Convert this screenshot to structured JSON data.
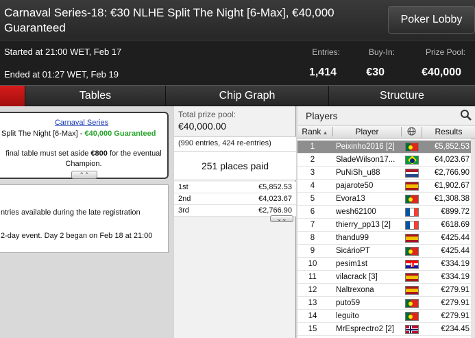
{
  "header": {
    "title": "Carnaval Series-18: €30 NLHE Split The Night [6-Max], €40,000 Guaranteed",
    "lobby_button": "Poker Lobby",
    "started": "Started at 21:00 WET, Feb 17",
    "ended": "Ended at 01:27 WET, Feb 19",
    "stats": {
      "entries_label": "Entries:",
      "entries_value": "1,414",
      "buyin_label": "Buy-In:",
      "buyin_value": "€30",
      "prize_label": "Prize Pool:",
      "prize_value": "€40,000"
    }
  },
  "tabs": [
    {
      "label": ""
    },
    {
      "label": "Tables"
    },
    {
      "label": "Chip Graph"
    },
    {
      "label": "Structure"
    }
  ],
  "info": {
    "link": "Carnaval Series",
    "subline_a": "Split The Night [6-Max]",
    "subline_sep": " - ",
    "subline_b": "€40,000 Guaranteed",
    "note_a": "final table must set aside ",
    "note_bold": "€800",
    "note_b": " for the eventual Champion.",
    "late_reg": "ntries available during the late registration",
    "day2": "2-day event. Day 2 began on Feb 18 at 21:00"
  },
  "prize": {
    "label": "Total prize pool:",
    "value": "€40,000.00",
    "entries": "(990 entries, 424 re-entries)",
    "places": "251 places paid",
    "payouts": [
      {
        "place": "1st",
        "amount": "€5,852.53"
      },
      {
        "place": "2nd",
        "amount": "€4,023.67"
      },
      {
        "place": "3rd",
        "amount": "€2,766.90"
      }
    ]
  },
  "players": {
    "title": "Players",
    "columns": {
      "rank": "Rank",
      "player": "Player",
      "results": "Results"
    },
    "rows": [
      {
        "rank": "1",
        "name": "Peixinho2016 [2]",
        "flag": "portugal",
        "result": "€5,852.53"
      },
      {
        "rank": "2",
        "name": "SladeWilson17...",
        "flag": "brazil",
        "result": "€4,023.67"
      },
      {
        "rank": "3",
        "name": "PuNiSh_u88",
        "flag": "netherlands",
        "result": "€2,766.90"
      },
      {
        "rank": "4",
        "name": "pajarote50",
        "flag": "spain",
        "result": "€1,902.67"
      },
      {
        "rank": "5",
        "name": "Evora13",
        "flag": "portugal",
        "result": "€1,308.38"
      },
      {
        "rank": "6",
        "name": "wesh62100",
        "flag": "france",
        "result": "€899.72"
      },
      {
        "rank": "7",
        "name": "thierry_pp13 [2]",
        "flag": "france",
        "result": "€618.69"
      },
      {
        "rank": "8",
        "name": "thandu99",
        "flag": "spain",
        "result": "€425.44"
      },
      {
        "rank": "9",
        "name": "SicárioPT",
        "flag": "portugal",
        "result": "€425.44"
      },
      {
        "rank": "10",
        "name": "pesim1st",
        "flag": "croatia",
        "result": "€334.19"
      },
      {
        "rank": "11",
        "name": "vilacrack [3]",
        "flag": "spain",
        "result": "€334.19"
      },
      {
        "rank": "12",
        "name": "Naltrexona",
        "flag": "spain",
        "result": "€279.91"
      },
      {
        "rank": "13",
        "name": "puto59",
        "flag": "portugal",
        "result": "€279.91"
      },
      {
        "rank": "14",
        "name": "leguito",
        "flag": "portugal",
        "result": "€279.91"
      },
      {
        "rank": "15",
        "name": "MrEsprectro2 [2]",
        "flag": "norway",
        "result": "€234.45"
      }
    ]
  },
  "colors": {
    "accent_red": "#c31313",
    "guarantee_green": "#27a52b",
    "link_blue": "#1a3bb5",
    "selected_row": "#8e8e8e"
  }
}
